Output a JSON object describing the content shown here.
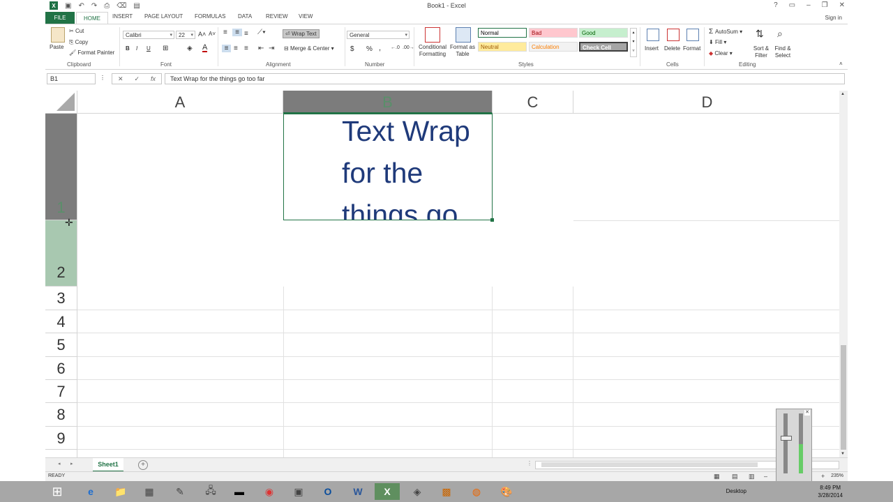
{
  "window": {
    "title": "Book1 - Excel",
    "signin": "Sign in"
  },
  "tabs": [
    "FILE",
    "HOME",
    "INSERT",
    "PAGE LAYOUT",
    "FORMULAS",
    "DATA",
    "REVIEW",
    "VIEW"
  ],
  "ribbon": {
    "clipboard": {
      "label": "Clipboard",
      "paste": "Paste",
      "cut": "Cut",
      "copy": "Copy",
      "format_painter": "Format Painter"
    },
    "font": {
      "label": "Font",
      "name": "Calibri",
      "size": "22",
      "bold": "B",
      "italic": "I",
      "underline": "U"
    },
    "alignment": {
      "label": "Alignment",
      "wrap_text": "Wrap Text",
      "merge_center": "Merge & Center"
    },
    "number": {
      "label": "Number",
      "format": "General",
      "currency": "$",
      "percent": "%",
      "comma": ","
    },
    "styles": {
      "label": "Styles",
      "conditional": "Conditional Formatting",
      "format_as_table": "Format as Table",
      "cells": [
        {
          "name": "Normal",
          "bg": "#ffffff",
          "fg": "#000000"
        },
        {
          "name": "Bad",
          "bg": "#ffc7ce",
          "fg": "#9c0006"
        },
        {
          "name": "Good",
          "bg": "#c6efce",
          "fg": "#006100"
        },
        {
          "name": "Neutral",
          "bg": "#ffeb9c",
          "fg": "#9c5700"
        },
        {
          "name": "Calculation",
          "bg": "#f2f2f2",
          "fg": "#fa7d00"
        },
        {
          "name": "Check Cell",
          "bg": "#a5a5a5",
          "fg": "#ffffff"
        }
      ]
    },
    "cells": {
      "label": "Cells",
      "insert": "Insert",
      "delete": "Delete",
      "format": "Format"
    },
    "editing": {
      "label": "Editing",
      "autosum": "AutoSum",
      "fill": "Fill",
      "clear": "Clear",
      "sort_filter": "Sort & Filter",
      "find_select": "Find & Select"
    }
  },
  "formula_bar": {
    "name_box": "B1",
    "fx": "fx",
    "value": "Text Wrap for the things go too far"
  },
  "columns": [
    "A",
    "B",
    "C",
    "D"
  ],
  "rows": [
    "1",
    "2",
    "3",
    "4",
    "5",
    "6",
    "7",
    "8",
    "9"
  ],
  "cell_b1": {
    "text": "Text Wrap for the things go too far"
  },
  "sheet": {
    "name": "Sheet1"
  },
  "status": {
    "mode": "READY",
    "zoom": "235%"
  },
  "taskbar": {
    "desktop": "Desktop",
    "time": "8:49 PM",
    "date": "3/28/2014"
  },
  "colors": {
    "accent": "#217346",
    "cell_text": "#1f3a7a"
  }
}
